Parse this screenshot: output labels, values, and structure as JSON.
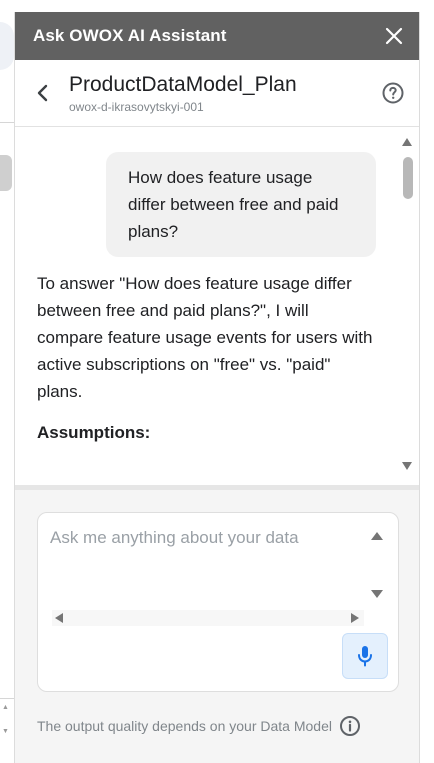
{
  "titlebar": {
    "title": "Ask OWOX AI Assistant"
  },
  "header": {
    "title": "ProductDataModel_Plan",
    "subtitle": "owox-d-ikrasovytskyi-001"
  },
  "chat": {
    "user_message": "How does feature usage differ between free and paid plans?",
    "assistant_message": "To answer \"How does feature usage differ between free and paid plans?\", I will compare feature usage events for users with active subscriptions on \"free\" vs. \"paid\" plans.",
    "assistant_heading": "Assumptions:"
  },
  "composer": {
    "placeholder": "Ask me anything about your data"
  },
  "footer": {
    "note": "The output quality depends on your Data Model"
  },
  "icons": {
    "close": "close-icon",
    "back": "chevron-left-icon",
    "help": "help-circle-icon",
    "mic": "microphone-icon",
    "info": "info-icon"
  },
  "colors": {
    "titlebar_bg": "#616161",
    "bubble_bg": "#f1f1f1",
    "mic_accent": "#1a73e8",
    "composer_area_bg": "#f5f5f5"
  }
}
